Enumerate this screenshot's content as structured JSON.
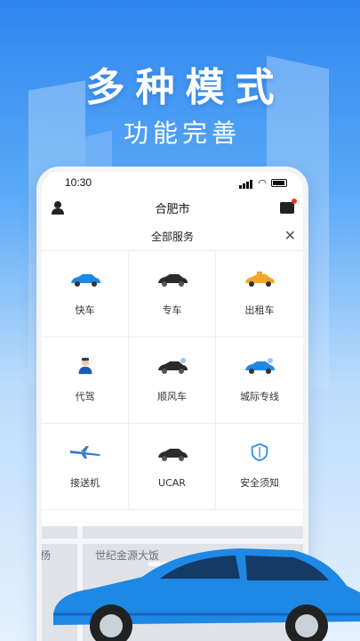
{
  "promo": {
    "title": "多种模式",
    "subtitle": "功能完善"
  },
  "status_bar": {
    "time": "10:30"
  },
  "nav": {
    "city": "合肥市"
  },
  "services": {
    "title": "全部服务",
    "items": [
      {
        "label": "快车",
        "icon": "blue-car-icon"
      },
      {
        "label": "专车",
        "icon": "black-sedan-icon"
      },
      {
        "label": "出租车",
        "icon": "taxi-icon"
      },
      {
        "label": "代驾",
        "icon": "driver-icon"
      },
      {
        "label": "顺风车",
        "icon": "hitch-car-icon"
      },
      {
        "label": "城际专线",
        "icon": "intercity-car-icon"
      },
      {
        "label": "接送机",
        "icon": "airplane-icon"
      },
      {
        "label": "UCAR",
        "icon": "ucar-icon"
      },
      {
        "label": "安全须知",
        "icon": "shield-icon"
      }
    ]
  },
  "map": {
    "label": "世纪金源大饭",
    "label_left": "杨"
  },
  "colors": {
    "accent": "#2f86ee",
    "car": "#1e88e5"
  }
}
